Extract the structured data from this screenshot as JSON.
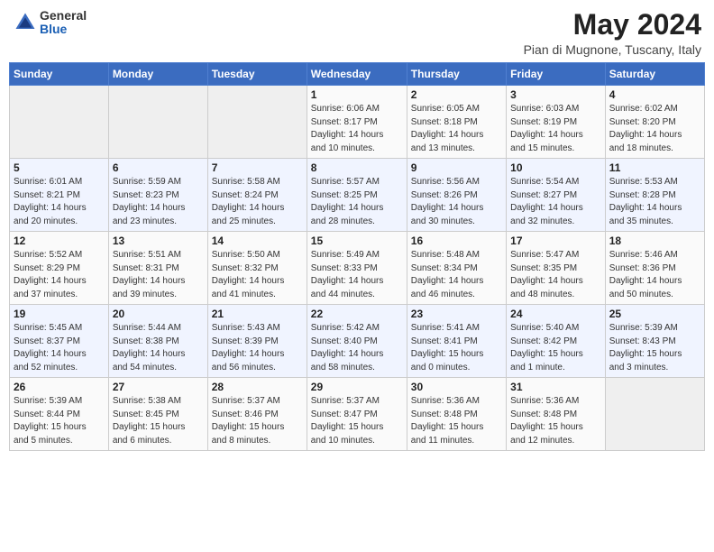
{
  "header": {
    "logo_general": "General",
    "logo_blue": "Blue",
    "month_title": "May 2024",
    "location": "Pian di Mugnone, Tuscany, Italy"
  },
  "weekdays": [
    "Sunday",
    "Monday",
    "Tuesday",
    "Wednesday",
    "Thursday",
    "Friday",
    "Saturday"
  ],
  "weeks": [
    [
      {
        "day": "",
        "info": ""
      },
      {
        "day": "",
        "info": ""
      },
      {
        "day": "",
        "info": ""
      },
      {
        "day": "1",
        "info": "Sunrise: 6:06 AM\nSunset: 8:17 PM\nDaylight: 14 hours\nand 10 minutes."
      },
      {
        "day": "2",
        "info": "Sunrise: 6:05 AM\nSunset: 8:18 PM\nDaylight: 14 hours\nand 13 minutes."
      },
      {
        "day": "3",
        "info": "Sunrise: 6:03 AM\nSunset: 8:19 PM\nDaylight: 14 hours\nand 15 minutes."
      },
      {
        "day": "4",
        "info": "Sunrise: 6:02 AM\nSunset: 8:20 PM\nDaylight: 14 hours\nand 18 minutes."
      }
    ],
    [
      {
        "day": "5",
        "info": "Sunrise: 6:01 AM\nSunset: 8:21 PM\nDaylight: 14 hours\nand 20 minutes."
      },
      {
        "day": "6",
        "info": "Sunrise: 5:59 AM\nSunset: 8:23 PM\nDaylight: 14 hours\nand 23 minutes."
      },
      {
        "day": "7",
        "info": "Sunrise: 5:58 AM\nSunset: 8:24 PM\nDaylight: 14 hours\nand 25 minutes."
      },
      {
        "day": "8",
        "info": "Sunrise: 5:57 AM\nSunset: 8:25 PM\nDaylight: 14 hours\nand 28 minutes."
      },
      {
        "day": "9",
        "info": "Sunrise: 5:56 AM\nSunset: 8:26 PM\nDaylight: 14 hours\nand 30 minutes."
      },
      {
        "day": "10",
        "info": "Sunrise: 5:54 AM\nSunset: 8:27 PM\nDaylight: 14 hours\nand 32 minutes."
      },
      {
        "day": "11",
        "info": "Sunrise: 5:53 AM\nSunset: 8:28 PM\nDaylight: 14 hours\nand 35 minutes."
      }
    ],
    [
      {
        "day": "12",
        "info": "Sunrise: 5:52 AM\nSunset: 8:29 PM\nDaylight: 14 hours\nand 37 minutes."
      },
      {
        "day": "13",
        "info": "Sunrise: 5:51 AM\nSunset: 8:31 PM\nDaylight: 14 hours\nand 39 minutes."
      },
      {
        "day": "14",
        "info": "Sunrise: 5:50 AM\nSunset: 8:32 PM\nDaylight: 14 hours\nand 41 minutes."
      },
      {
        "day": "15",
        "info": "Sunrise: 5:49 AM\nSunset: 8:33 PM\nDaylight: 14 hours\nand 44 minutes."
      },
      {
        "day": "16",
        "info": "Sunrise: 5:48 AM\nSunset: 8:34 PM\nDaylight: 14 hours\nand 46 minutes."
      },
      {
        "day": "17",
        "info": "Sunrise: 5:47 AM\nSunset: 8:35 PM\nDaylight: 14 hours\nand 48 minutes."
      },
      {
        "day": "18",
        "info": "Sunrise: 5:46 AM\nSunset: 8:36 PM\nDaylight: 14 hours\nand 50 minutes."
      }
    ],
    [
      {
        "day": "19",
        "info": "Sunrise: 5:45 AM\nSunset: 8:37 PM\nDaylight: 14 hours\nand 52 minutes."
      },
      {
        "day": "20",
        "info": "Sunrise: 5:44 AM\nSunset: 8:38 PM\nDaylight: 14 hours\nand 54 minutes."
      },
      {
        "day": "21",
        "info": "Sunrise: 5:43 AM\nSunset: 8:39 PM\nDaylight: 14 hours\nand 56 minutes."
      },
      {
        "day": "22",
        "info": "Sunrise: 5:42 AM\nSunset: 8:40 PM\nDaylight: 14 hours\nand 58 minutes."
      },
      {
        "day": "23",
        "info": "Sunrise: 5:41 AM\nSunset: 8:41 PM\nDaylight: 15 hours\nand 0 minutes."
      },
      {
        "day": "24",
        "info": "Sunrise: 5:40 AM\nSunset: 8:42 PM\nDaylight: 15 hours\nand 1 minute."
      },
      {
        "day": "25",
        "info": "Sunrise: 5:39 AM\nSunset: 8:43 PM\nDaylight: 15 hours\nand 3 minutes."
      }
    ],
    [
      {
        "day": "26",
        "info": "Sunrise: 5:39 AM\nSunset: 8:44 PM\nDaylight: 15 hours\nand 5 minutes."
      },
      {
        "day": "27",
        "info": "Sunrise: 5:38 AM\nSunset: 8:45 PM\nDaylight: 15 hours\nand 6 minutes."
      },
      {
        "day": "28",
        "info": "Sunrise: 5:37 AM\nSunset: 8:46 PM\nDaylight: 15 hours\nand 8 minutes."
      },
      {
        "day": "29",
        "info": "Sunrise: 5:37 AM\nSunset: 8:47 PM\nDaylight: 15 hours\nand 10 minutes."
      },
      {
        "day": "30",
        "info": "Sunrise: 5:36 AM\nSunset: 8:48 PM\nDaylight: 15 hours\nand 11 minutes."
      },
      {
        "day": "31",
        "info": "Sunrise: 5:36 AM\nSunset: 8:48 PM\nDaylight: 15 hours\nand 12 minutes."
      },
      {
        "day": "",
        "info": ""
      }
    ]
  ]
}
